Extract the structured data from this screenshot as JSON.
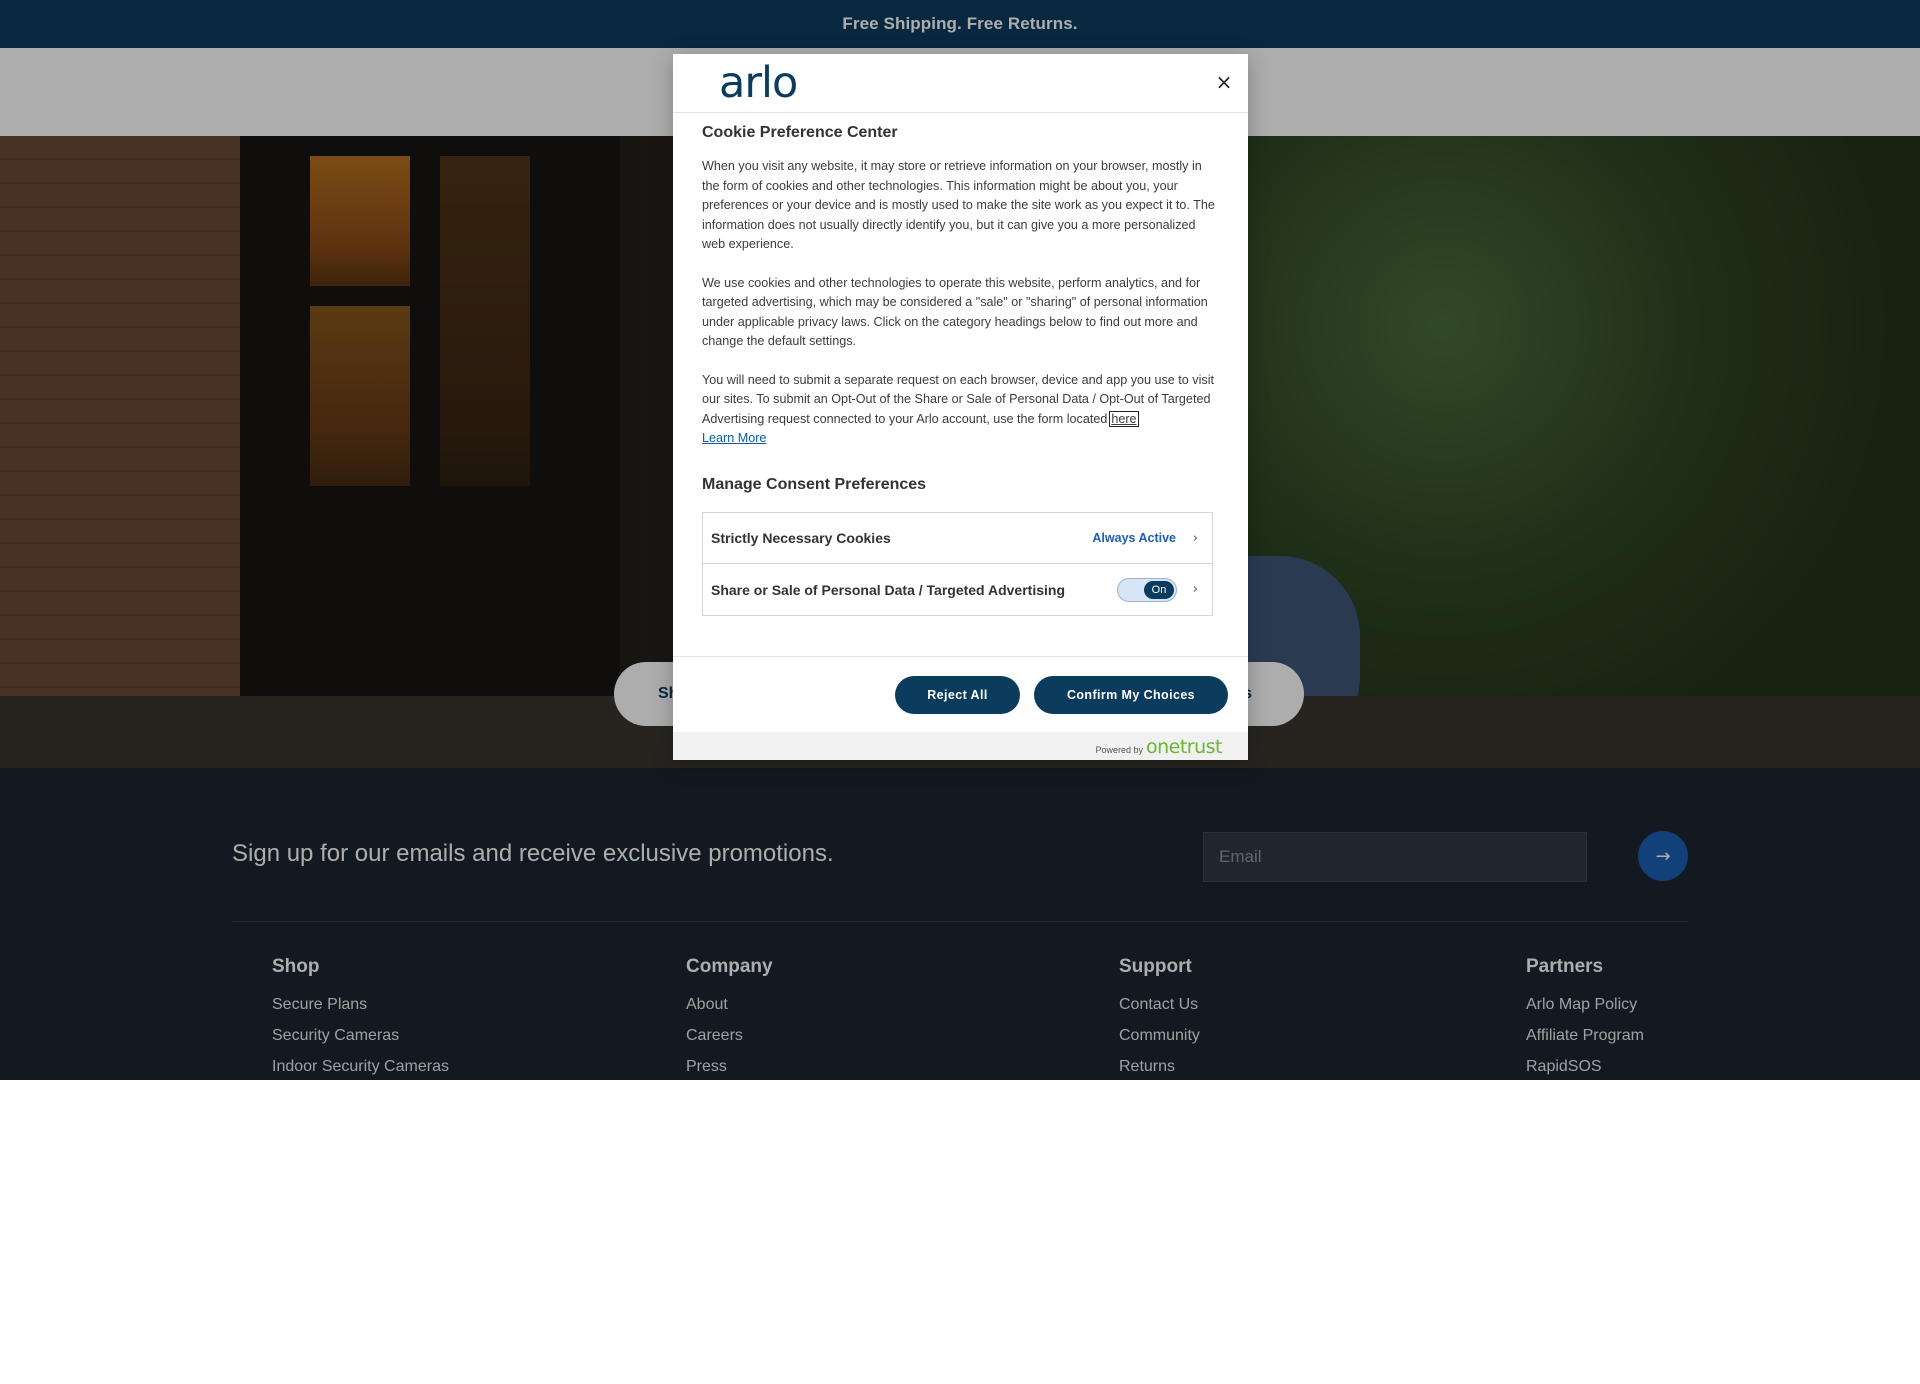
{
  "announcement": "Free Shipping. Free Returns.",
  "hero": {
    "button_left": "Sh",
    "button_right": "s"
  },
  "signup": {
    "text": "Sign up for our emails and receive exclusive promotions.",
    "email_placeholder": "Email",
    "submit_icon": "→"
  },
  "footer": {
    "columns": [
      {
        "heading": "Shop",
        "links": [
          "Secure Plans",
          "Security Cameras",
          "Indoor Security Cameras"
        ]
      },
      {
        "heading": "Company",
        "links": [
          "About",
          "Careers",
          "Press"
        ]
      },
      {
        "heading": "Support",
        "links": [
          "Contact Us",
          "Community",
          "Returns"
        ]
      },
      {
        "heading": "Partners",
        "links": [
          "Arlo Map Policy",
          "Affiliate Program",
          "RapidSOS"
        ]
      }
    ]
  },
  "modal": {
    "logo": "arlo",
    "close": "×",
    "title": "Cookie Preference Center",
    "paragraphs": [
      "When you visit any website, it may store or retrieve information on your browser, mostly in the form of cookies and other technologies. This information might be about you, your preferences or your device and is mostly used to make the site work as you expect it to. The information does not usually directly identify you, but it can give you a more personalized web experience.",
      "We use cookies and other technologies to operate this website, perform analytics, and for targeted advertising, which may be considered a \"sale\" or \"sharing\" of personal information under applicable privacy laws. Click on the category headings below to find out more and change the default settings.",
      "You will need to submit a separate request on each browser, device and app you use to visit our sites. To submit an Opt-Out of the Share or Sale of Personal Data / Opt-Out of Targeted Advertising request connected to your Arlo account, use the form located"
    ],
    "here_link": "here",
    "learn_more": "Learn More",
    "subtitle": "Manage Consent Preferences",
    "consent_rows": [
      {
        "label": "Strictly Necessary Cookies",
        "status": "Always Active",
        "chevron": "›"
      },
      {
        "label": "Share or Sale of Personal Data / Targeted Advertising",
        "toggle": "On",
        "chevron": "›"
      }
    ],
    "reject_label": "Reject All",
    "confirm_label": "Confirm My Choices",
    "powered_by": "Powered by",
    "brand": "onetrust"
  },
  "colors": {
    "brand_navy": "#0b3c5d",
    "link_blue": "#1b5fb3",
    "onetrust_green": "#68b631",
    "footer_bg": "#1b2530"
  }
}
